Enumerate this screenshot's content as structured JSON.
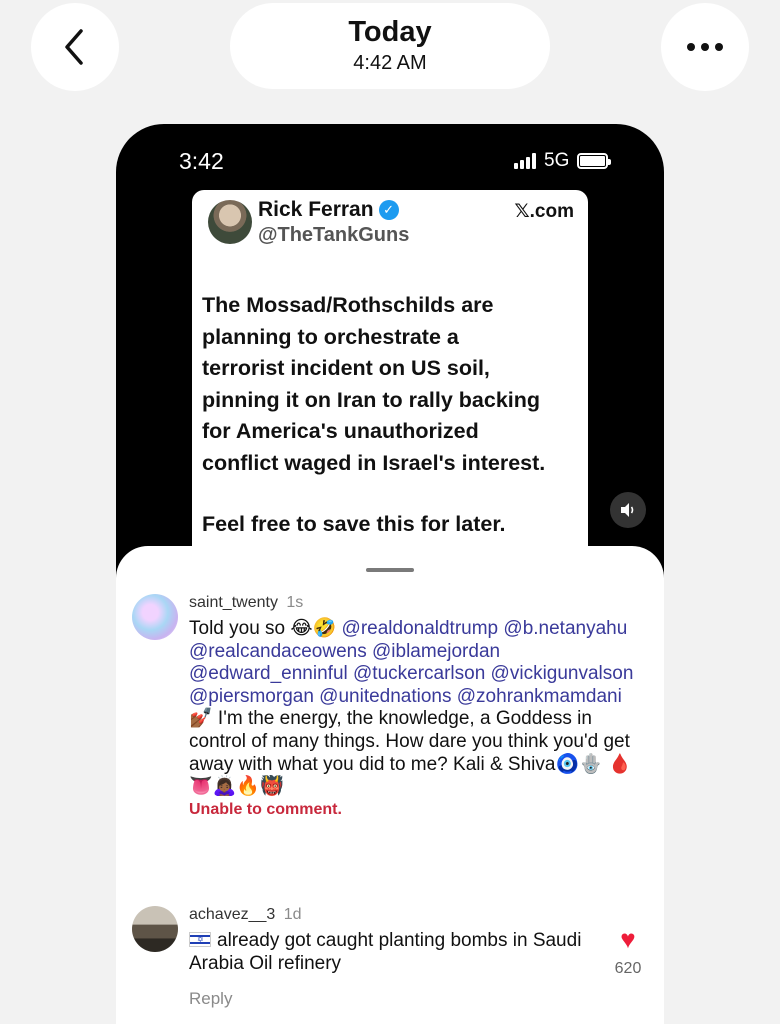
{
  "header": {
    "title": "Today",
    "time": "4:42 AM",
    "back_icon": "chevron-left-icon",
    "more_icon": "more-horizontal-icon"
  },
  "phone": {
    "status_time": "3:42",
    "network": "5G",
    "tweet": {
      "author": "Rick Ferran",
      "handle": "@TheTankGuns",
      "domain": "𝕏.com",
      "verified_color": "#1d9bf0",
      "text": "The Mossad/Rothschilds are\nplanning to orchestrate a\nterrorist incident on US soil,\npinning it on Iran to rally backing\nfor America's unauthorized\nconflict waged in Israel's interest.",
      "text2": "Feel free to save this for later."
    }
  },
  "comments": [
    {
      "username": "saint_twenty",
      "time_ago": "1s",
      "text_parts": {
        "intro": "Told you so 😂🤣 ",
        "mentions": "@realdonaldtrump @b.netanyahu @realcandaceowens @iblamejordan @edward_enninful @tuckercarlson @vickigunvalson @piersmorgan @unitednations @zohrankmamdani",
        "body": " 💅🏾 I'm the energy, the knowledge, a Goddess in control of many things. How dare you think you'd get away with what you did to me? Kali & Shiva🧿🪬 🩸👅🙇🏾‍♀️🔥👹"
      },
      "status": "Unable to comment."
    },
    {
      "username": "achavez__3",
      "time_ago": "1d",
      "text": "already got caught planting bombs in Saudi Arabia Oil refinery",
      "reply_label": "Reply",
      "likes": "620",
      "like_color": "#ee1d3a"
    }
  ]
}
